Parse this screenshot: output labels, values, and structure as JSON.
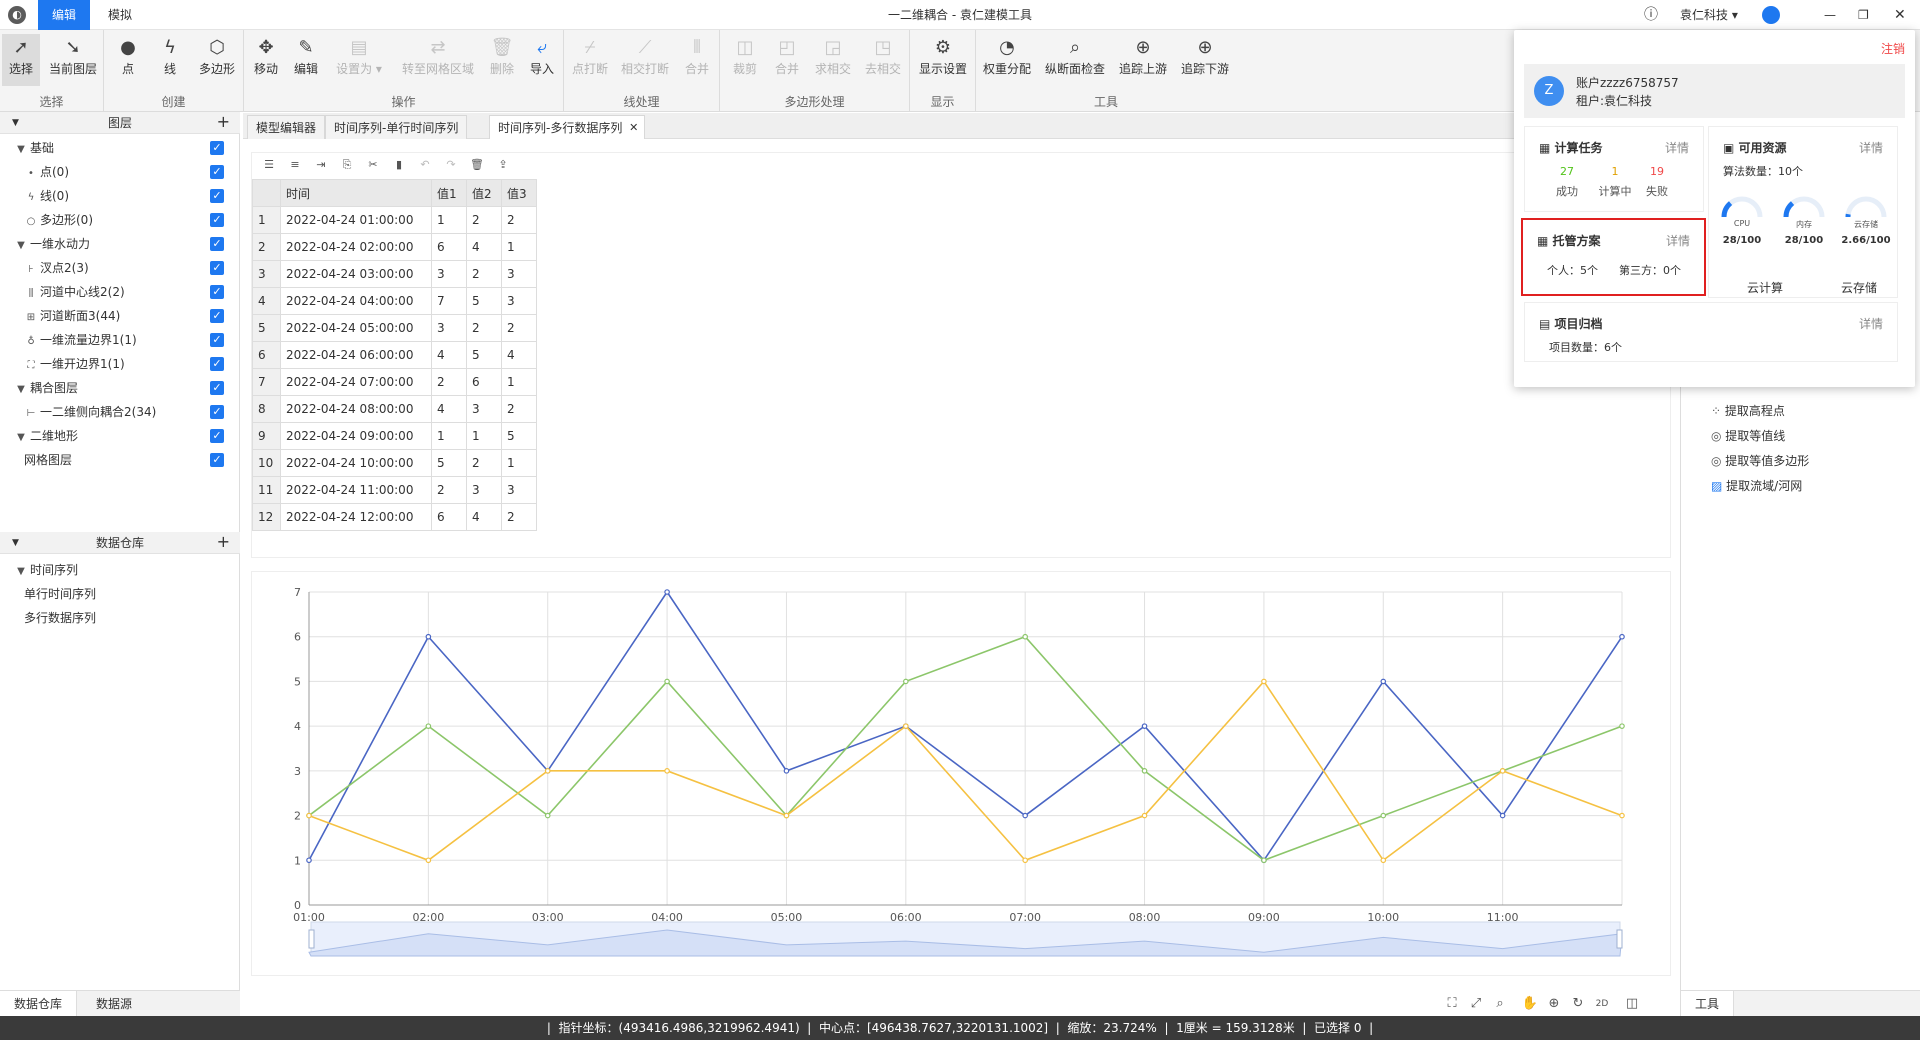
{
  "titlebar": {
    "menu_edit": "编辑",
    "menu_sim": "模拟",
    "window_title": "一二维耦合 - 袁仁建模工具",
    "company": "袁仁科技"
  },
  "toolbar": {
    "groups": {
      "select": "选择",
      "create": "创建",
      "operate": "操作",
      "line": "线处理",
      "polygon": "多边形处理",
      "display": "显示",
      "tools": "工具"
    },
    "buttons": {
      "select": "选择",
      "current_layer": "当前图层",
      "point": "点",
      "line": "线",
      "polygon": "多边形",
      "move": "移动",
      "edit": "编辑",
      "set_as": "设置为",
      "to_grid": "转至网格区域",
      "delete": "删除",
      "import": "导入",
      "point_break": "点打断",
      "intersect_break": "相交打断",
      "merge_line": "合并",
      "clip": "裁剪",
      "merge_poly": "合并",
      "intersect": "求相交",
      "remove_intersect": "去相交",
      "display_settings": "显示设置",
      "weight_distribution": "权重分配",
      "profile_check": "纵断面检查",
      "trace_up": "追踪上游",
      "trace_down": "追踪下游"
    }
  },
  "layers": {
    "header": "图层",
    "items": [
      "基础",
      "点(0)",
      "线(0)",
      "多边形(0)",
      "一维水动力",
      "汊点2(3)",
      "河道中心线2(2)",
      "河道断面3(44)",
      "一维流量边界1(1)",
      "一维开边界1(1)",
      "耦合图层",
      "一二维侧向耦合2(34)",
      "二维地形",
      "网格图层"
    ]
  },
  "warehouse": {
    "header": "数据仓库",
    "items": [
      "时间序列",
      "单行时间序列",
      "多行数据序列"
    ]
  },
  "bottom_tabs": [
    "数据仓库",
    "数据源"
  ],
  "doc_tabs": [
    "模型编辑器",
    "时间序列-单行时间序列",
    "时间序列-多行数据序列"
  ],
  "table": {
    "headers": [
      "",
      "时间",
      "值1",
      "值2",
      "值3"
    ],
    "rows": [
      [
        "1",
        "2022-04-24 01:00:00",
        "1",
        "2",
        "2"
      ],
      [
        "2",
        "2022-04-24 02:00:00",
        "6",
        "4",
        "1"
      ],
      [
        "3",
        "2022-04-24 03:00:00",
        "3",
        "2",
        "3"
      ],
      [
        "4",
        "2022-04-24 04:00:00",
        "7",
        "5",
        "3"
      ],
      [
        "5",
        "2022-04-24 05:00:00",
        "3",
        "2",
        "2"
      ],
      [
        "6",
        "2022-04-24 06:00:00",
        "4",
        "5",
        "4"
      ],
      [
        "7",
        "2022-04-24 07:00:00",
        "2",
        "6",
        "1"
      ],
      [
        "8",
        "2022-04-24 08:00:00",
        "4",
        "3",
        "2"
      ],
      [
        "9",
        "2022-04-24 09:00:00",
        "1",
        "1",
        "5"
      ],
      [
        "10",
        "2022-04-24 10:00:00",
        "5",
        "2",
        "1"
      ],
      [
        "11",
        "2022-04-24 11:00:00",
        "2",
        "3",
        "3"
      ],
      [
        "12",
        "2022-04-24 12:00:00",
        "6",
        "4",
        "2"
      ]
    ]
  },
  "chart_data": {
    "type": "line",
    "x": [
      "01:00",
      "02:00",
      "03:00",
      "04:00",
      "05:00",
      "06:00",
      "07:00",
      "08:00",
      "09:00",
      "10:00",
      "11:00",
      "12:00"
    ],
    "x_tick_labels": [
      "01:00",
      "02:00",
      "03:00",
      "04:00",
      "05:00",
      "06:00",
      "07:00",
      "08:00",
      "09:00",
      "10:00",
      "11:00"
    ],
    "ylim": [
      0,
      7
    ],
    "yticks": [
      0,
      1,
      2,
      3,
      4,
      5,
      6,
      7
    ],
    "grid": true,
    "series": [
      {
        "values": [
          1,
          6,
          3,
          7,
          3,
          4,
          2,
          4,
          1,
          5,
          2,
          6
        ],
        "color": "#4a66c4"
      },
      {
        "values": [
          2,
          4,
          2,
          5,
          2,
          5,
          6,
          3,
          1,
          2,
          3,
          4
        ],
        "color": "#8cc66a"
      },
      {
        "values": [
          2,
          1,
          3,
          3,
          2,
          4,
          1,
          2,
          5,
          1,
          3,
          2
        ],
        "color": "#f5c142"
      }
    ]
  },
  "right_tools": [
    "提取高程点",
    "提取等值线",
    "提取等值多边形",
    "提取流域/河网"
  ],
  "right_tab": "工具",
  "popup": {
    "logout": "注销",
    "avatar_letter": "Z",
    "account": "账户zzzz6758757",
    "tenant": "租户:袁仁科技",
    "detail": "详情",
    "compute_title": "计算任务",
    "compute_stats": [
      {
        "value": "27",
        "label": "成功",
        "color": "#52c41a"
      },
      {
        "value": "1",
        "label": "计算中",
        "color": "#e0a000"
      },
      {
        "value": "19",
        "label": "失败",
        "color": "#f04848"
      }
    ],
    "hosting_title": "托管方案",
    "hosting_personal": "个人：5个",
    "hosting_third": "第三方：0个",
    "project_title": "项目归档",
    "project_count": "项目数量：6个",
    "resource_title": "可用资源",
    "algo_count": "算法数量：10个",
    "gauges": [
      {
        "label": "CPU",
        "value": "28/100",
        "fraction": 0.28
      },
      {
        "label": "内存",
        "value": "28/100",
        "fraction": 0.28
      },
      {
        "label": "云存储",
        "value": "2.66/100",
        "fraction": 0.0266
      }
    ],
    "cloud_compute": "云计算",
    "cloud_storage": "云存储"
  },
  "status": {
    "pointer": "指针坐标：(493416.4986,3219962.4941)",
    "center": "中心点：[496438.7627,3220131.1002]",
    "zoom": "缩放：23.724%",
    "scale": "1厘米 = 159.3128米",
    "selected": "已选择 0"
  }
}
